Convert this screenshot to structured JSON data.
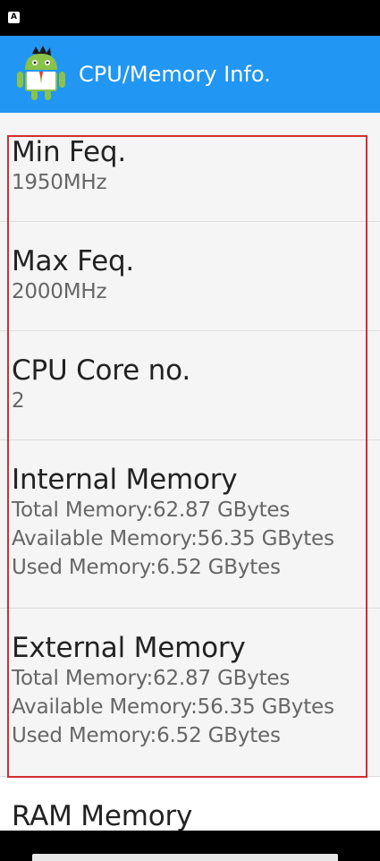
{
  "status_bar": {
    "icon": "A"
  },
  "app_bar": {
    "title": "CPU/Memory Info.",
    "icon": "android-robot-icon"
  },
  "items": [
    {
      "title": "Min Feq.",
      "lines": [
        "1950MHz"
      ]
    },
    {
      "title": "Max Feq.",
      "lines": [
        "2000MHz"
      ]
    },
    {
      "title": "CPU Core no.",
      "lines": [
        "2"
      ]
    },
    {
      "title": "Internal Memory",
      "lines": [
        "Total Memory:62.87 GBytes",
        "Available Memory:56.35 GBytes",
        "Used Memory:6.52 GBytes"
      ]
    },
    {
      "title": "External Memory",
      "lines": [
        "Total Memory:62.87 GBytes",
        "Available Memory:56.35 GBytes",
        "Used Memory:6.52 GBytes"
      ]
    },
    {
      "title": "RAM Memory",
      "lines": []
    }
  ],
  "colors": {
    "app_bar": "#2196f3",
    "highlight": "#d32f2f",
    "list_bg": "#f5f5f5"
  }
}
